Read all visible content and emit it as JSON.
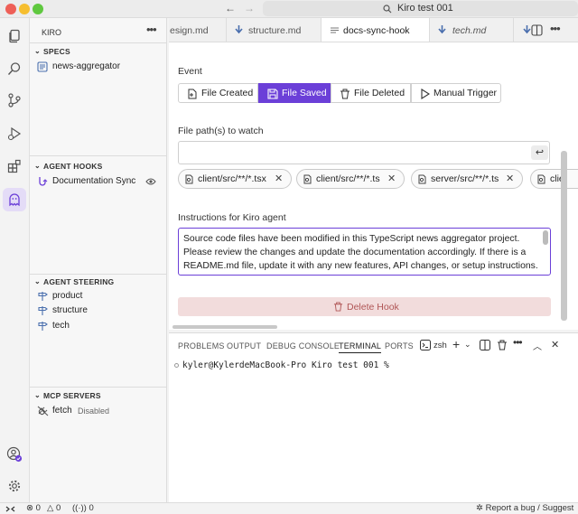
{
  "window": {
    "title": "Kiro test 001"
  },
  "sidebar": {
    "title": "KIRO",
    "specs": {
      "heading": "SPECS",
      "items": [
        {
          "label": "news-aggregator"
        }
      ]
    },
    "hooks": {
      "heading": "AGENT HOOKS",
      "items": [
        {
          "label": "Documentation Sync"
        }
      ]
    },
    "steering": {
      "heading": "AGENT STEERING",
      "items": [
        {
          "label": "product"
        },
        {
          "label": "structure"
        },
        {
          "label": "tech"
        }
      ]
    },
    "mcp": {
      "heading": "MCP SERVERS",
      "items": [
        {
          "label": "fetch",
          "status": "Disabled"
        }
      ]
    }
  },
  "tabs": [
    {
      "label": "esign.md"
    },
    {
      "label": "structure.md"
    },
    {
      "label": "docs-sync-hook"
    },
    {
      "label": "tech.md"
    }
  ],
  "hook_editor": {
    "event_label": "Event",
    "events": [
      {
        "label": "File Created"
      },
      {
        "label": "File Saved"
      },
      {
        "label": "File Deleted"
      },
      {
        "label": "Manual Trigger"
      }
    ],
    "selected_event": "File Saved",
    "paths_label": "File path(s) to watch",
    "path_input_value": "",
    "enter_symbol": "↩",
    "patterns": [
      "client/src/**/*.tsx",
      "client/src/**/*.ts",
      "server/src/**/*.ts",
      "clie"
    ],
    "instructions_label": "Instructions for Kiro agent",
    "instructions_lines": [
      "Source code files have been modified in this TypeScript news aggregator project.",
      "Please review the changes and update the documentation accordingly. If there is a",
      "README.md file, update it with any new features, API changes, or setup instructions."
    ],
    "delete_label": "Delete Hook"
  },
  "panel": {
    "tabs": [
      "PROBLEMS",
      "OUTPUT",
      "DEBUG CONSOLE",
      "TERMINAL",
      "PORTS"
    ],
    "active_tab": "TERMINAL",
    "shell": "zsh",
    "prompt": "kyler@KylerdeMacBook-Pro Kiro test 001 %"
  },
  "status": {
    "errors": "0",
    "warnings": "0",
    "ports": "0",
    "right_text": "Report a bug / Suggest"
  },
  "colors": {
    "accent": "#6b3fd8",
    "delete_bg": "#f2dcdc",
    "delete_text": "#b05656"
  },
  "icons": {
    "activity": [
      "explorer-icon",
      "search-icon",
      "source-control-icon",
      "run-debug-icon",
      "extensions-icon",
      "kiro-ghost-icon",
      "account-icon",
      "settings-icon"
    ]
  }
}
